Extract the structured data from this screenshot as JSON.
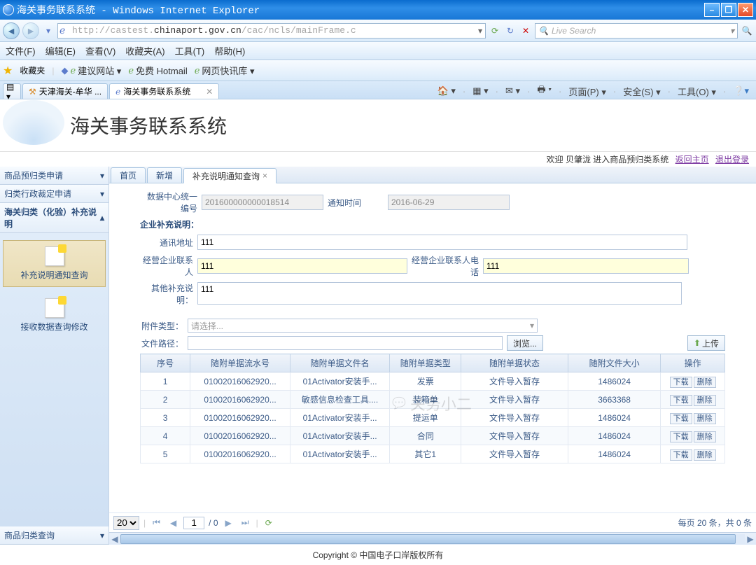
{
  "window": {
    "title": "海关事务联系系统 - Windows Internet Explorer"
  },
  "url": {
    "prefix": "http://castest.",
    "host": "chinaport.gov.cn",
    "rest": "/cac/ncls/mainFrame.c"
  },
  "search": {
    "placeholder": "Live Search"
  },
  "menus": {
    "file": "文件(F)",
    "edit": "编辑(E)",
    "view": "查看(V)",
    "fav": "收藏夹(A)",
    "tools": "工具(T)",
    "help": "帮助(H)"
  },
  "favbar": {
    "label": "收藏夹",
    "site": "建议网站 ▾",
    "hotmail": "免费 Hotmail",
    "gallery": "网页快讯库 ▾"
  },
  "tabs": {
    "t1": "天津海关-牟华 ...",
    "t2": "海关事务联系系统"
  },
  "toolgroup": {
    "page": "页面(P) ▾",
    "safe": "安全(S) ▾",
    "tools": "工具(O) ▾"
  },
  "app": {
    "title": "海关事务联系系统"
  },
  "userbar": {
    "welcome": "欢迎  贝肇泷  进入商品预归类系统",
    "home": "返回主页",
    "logout": "退出登录"
  },
  "sidebar": {
    "a1": "商品预归类申请",
    "a2": "归类行政裁定申请",
    "a3": "海关归类（化验）补充说明",
    "items": [
      {
        "label": "补充说明通知查询"
      },
      {
        "label": "接收数据查询修改"
      }
    ],
    "a4": "商品归类查询"
  },
  "innerTabs": {
    "t1": "首页",
    "t2": "新增",
    "t3": "补充说明通知查询"
  },
  "form": {
    "idlabel": "数据中心统一编号",
    "id": "201600000000018514",
    "timelabel": "通知时间",
    "time": "2016-06-29",
    "suppTitle": "企业补充说明：",
    "addrlabel": "通讯地址",
    "addr": "111",
    "contactlabel": "经营企业联系人",
    "contact": "111",
    "phonelabel": "经营企业联系人电话",
    "phone": "111",
    "otherlabel": "其他补充说明：",
    "other": "111",
    "atttype": "附件类型：",
    "atttypeval": "请选择...",
    "pathlabel": "文件路径：",
    "browse": "浏览...",
    "upload": "上传"
  },
  "table": {
    "headers": [
      "序号",
      "随附单据流水号",
      "随附单据文件名",
      "随附单据类型",
      "随附单据状态",
      "随附文件大小",
      "操作"
    ],
    "rows": [
      {
        "c0": "1",
        "c1": "01002016062920...",
        "c2": "01Activator安装手...",
        "c3": "发票",
        "c4": "文件导入暂存",
        "c5": "1486024"
      },
      {
        "c0": "2",
        "c1": "01002016062920...",
        "c2": "敏感信息检查工具....",
        "c3": "装箱单",
        "c4": "文件导入暂存",
        "c5": "3663368"
      },
      {
        "c0": "3",
        "c1": "01002016062920...",
        "c2": "01Activator安装手...",
        "c3": "提运单",
        "c4": "文件导入暂存",
        "c5": "1486024"
      },
      {
        "c0": "4",
        "c1": "01002016062920...",
        "c2": "01Activator安装手...",
        "c3": "合同",
        "c4": "文件导入暂存",
        "c5": "1486024"
      },
      {
        "c0": "5",
        "c1": "01002016062920...",
        "c2": "01Activator安装手...",
        "c3": "其它1",
        "c4": "文件导入暂存",
        "c5": "1486024"
      }
    ],
    "actions": {
      "dl": "下载",
      "del": "删除"
    }
  },
  "pager": {
    "size": "20",
    "page": "1",
    "total": "/ 0",
    "summary": "每页  20 条，共  0 条"
  },
  "watermark": "关务小二",
  "footer": "Copyright © 中国电子口岸版权所有"
}
